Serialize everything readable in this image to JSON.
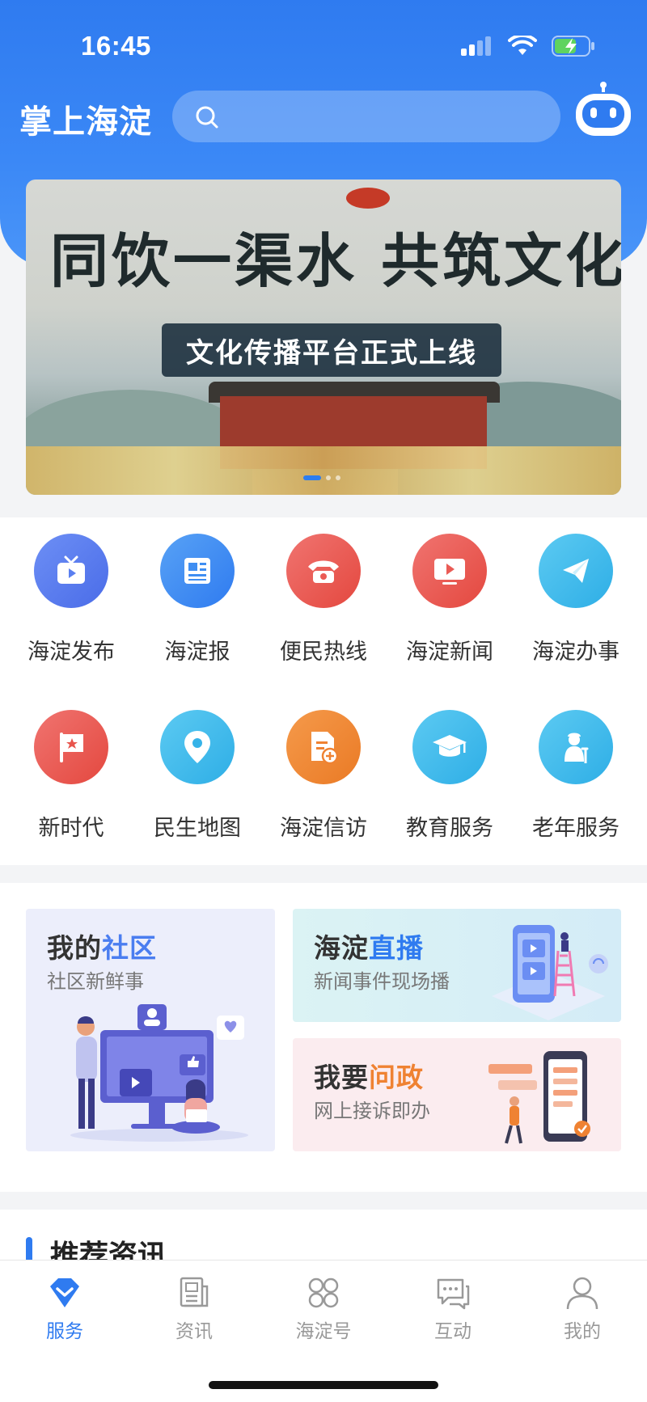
{
  "status_bar": {
    "time": "16:45"
  },
  "header": {
    "app_title": "掌上海淀",
    "search_placeholder": ""
  },
  "banner": {
    "title": "同饮一渠水 共筑文化魂",
    "subtitle": "文化传播平台正式上线",
    "page_index": 1,
    "page_count": 3
  },
  "services": [
    {
      "label": "海淀发布",
      "icon": "tv-icon",
      "color": "#5a7ff0"
    },
    {
      "label": "海淀报",
      "icon": "newspaper-icon",
      "color": "#3f8ef2"
    },
    {
      "label": "便民热线",
      "icon": "telephone-icon",
      "color": "#ea5b55"
    },
    {
      "label": "海淀新闻",
      "icon": "video-play-icon",
      "color": "#ea5b55"
    },
    {
      "label": "海淀办事",
      "icon": "paper-plane-icon",
      "color": "#37b6ea"
    },
    {
      "label": "新时代",
      "icon": "flag-icon",
      "color": "#e8554d"
    },
    {
      "label": "民生地图",
      "icon": "map-pin-icon",
      "color": "#36b3e8"
    },
    {
      "label": "海淀信访",
      "icon": "document-add-icon",
      "color": "#ef8232"
    },
    {
      "label": "教育服务",
      "icon": "graduation-cap-icon",
      "color": "#36b3e8"
    },
    {
      "label": "老年服务",
      "icon": "elderly-icon",
      "color": "#36b3e8"
    }
  ],
  "features": {
    "community": {
      "title_prefix": "我的",
      "title_highlight": "社区",
      "subtitle": "社区新鲜事",
      "highlight_color": "#4a7df0"
    },
    "live": {
      "title_prefix": "海淀",
      "title_highlight": "直播",
      "subtitle": "新闻事件现场播",
      "highlight_color": "#2f7bf0"
    },
    "gov": {
      "title_prefix": "我要",
      "title_highlight": "问政",
      "subtitle": "网上接诉即办",
      "highlight_color": "#ef8232"
    }
  },
  "recommendation": {
    "title": "推荐资讯"
  },
  "tabbar": [
    {
      "label": "服务",
      "icon": "service-diamond-icon",
      "active": true
    },
    {
      "label": "资讯",
      "icon": "news-icon",
      "active": false
    },
    {
      "label": "海淀号",
      "icon": "grid-icon",
      "active": false
    },
    {
      "label": "互动",
      "icon": "chat-icon",
      "active": false
    },
    {
      "label": "我的",
      "icon": "person-icon",
      "active": false
    }
  ],
  "colors": {
    "primary": "#2f7bf0",
    "tab_inactive": "#999999"
  }
}
